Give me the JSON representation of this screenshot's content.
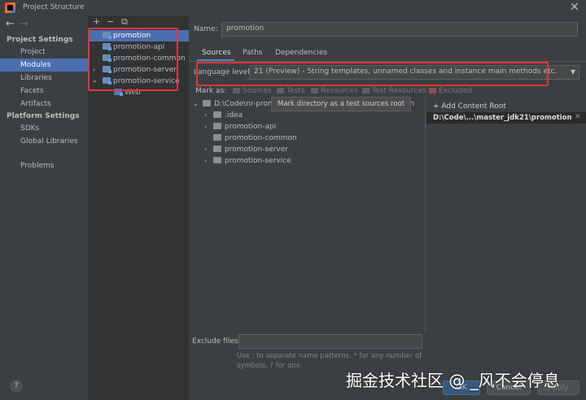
{
  "window": {
    "title": "Project Structure",
    "close_glyph": "✕"
  },
  "nav": {
    "back_glyph": "←",
    "forward_glyph": "→",
    "project_settings": "Project Settings",
    "items_project": [
      "Project",
      "Modules",
      "Libraries",
      "Facets",
      "Artifacts"
    ],
    "platform_settings": "Platform Settings",
    "items_platform": [
      "SDKs",
      "Global Libraries"
    ],
    "problems": "Problems"
  },
  "modules_toolbar": {
    "add": "+",
    "remove": "−",
    "copy": "⧉"
  },
  "modules": [
    {
      "name": "promotion",
      "selected": true
    },
    {
      "name": "promotion-api"
    },
    {
      "name": "promotion-common"
    },
    {
      "name": "promotion-server"
    },
    {
      "name": "promotion-service"
    }
  ],
  "modules_child": "Web",
  "detail": {
    "name_label": "Name:",
    "name_value": "promotion",
    "tabs": [
      "Sources",
      "Paths",
      "Dependencies"
    ],
    "active_tab": "Sources",
    "language_level_label": "Language level:",
    "language_level_value": "21 (Preview) - String templates, unnamed classes and instance main methods etc.",
    "mark_as_label": "Mark as:",
    "mark_as_items": [
      "Sources",
      "Tests",
      "Resources",
      "Test Resources",
      "Excluded"
    ],
    "tooltip": "Mark directory as a test sources root",
    "tree_root": "D:\\Code\\nr-prom",
    "tree_root_suffix": "on",
    "tree_children": [
      ".idea",
      "promotion-api",
      "promotion-common",
      "promotion-server",
      "promotion-service"
    ],
    "add_content_root": "+ Add Content Root",
    "content_root_path": "D:\\Code\\...\\master_jdk21\\promotion",
    "content_root_close": "✕",
    "exclude_label": "Exclude files:",
    "exclude_hint": "Use ; to separate name patterns, * for any number of symbols, ? for one."
  },
  "buttons": {
    "ok": "OK",
    "cancel": "Cancel",
    "apply": "Apply",
    "help": "?"
  },
  "watermark": "掘金技术社区 @ _风不会停息",
  "colors": {
    "selection": "#4b6eaf",
    "highlight_box": "#e0353a",
    "tab_underline": "#4a88c7"
  }
}
